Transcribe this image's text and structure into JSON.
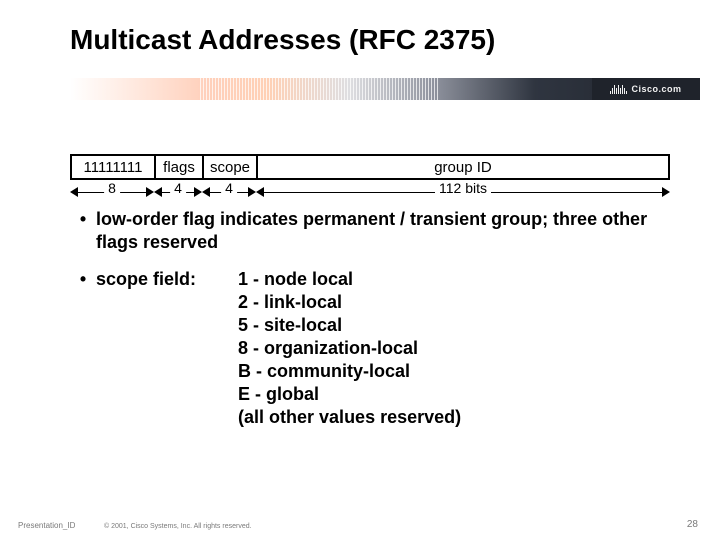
{
  "title": "Multicast Addresses (RFC 2375)",
  "brand": "Cisco.com",
  "addr": {
    "cells": [
      "11111111",
      "flags",
      "scope",
      "group ID"
    ],
    "widths": [
      "8",
      "4",
      "4",
      "112 bits"
    ]
  },
  "bullets": {
    "b1": "low-order flag indicates permanent / transient group; three other flags reserved",
    "b2_label": "scope field:",
    "scopes": [
      "1 - node local",
      "2 - link-local",
      "5 - site-local",
      "8 - organization-local",
      "B - community-local",
      "E - global",
      "(all other values reserved)"
    ]
  },
  "footer": {
    "id": "Presentation_ID",
    "copy": "© 2001, Cisco Systems, Inc. All rights reserved.",
    "page": "28"
  }
}
